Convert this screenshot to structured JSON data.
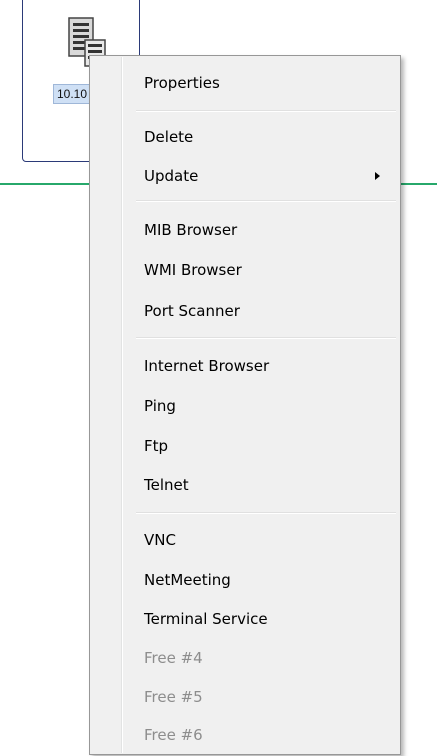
{
  "node": {
    "label": "10.10",
    "icon": "server-icon"
  },
  "colors": {
    "link_line": "#27a86b",
    "node_border": "#2b3a78",
    "label_bg": "#cfe0f5",
    "menu_bg": "#f0f0f0",
    "disabled_text": "#8d8d8d"
  },
  "menu": {
    "properties": "Properties",
    "delete": "Delete",
    "update": "Update",
    "mib_browser": "MIB Browser",
    "wmi_browser": "WMI Browser",
    "port_scanner": "Port Scanner",
    "internet_browser": "Internet Browser",
    "ping": "Ping",
    "ftp": "Ftp",
    "telnet": "Telnet",
    "vnc": "VNC",
    "netmeeting": "NetMeeting",
    "terminal_service": "Terminal Service",
    "free4": "Free #4",
    "free5": "Free #5",
    "free6": "Free #6"
  }
}
